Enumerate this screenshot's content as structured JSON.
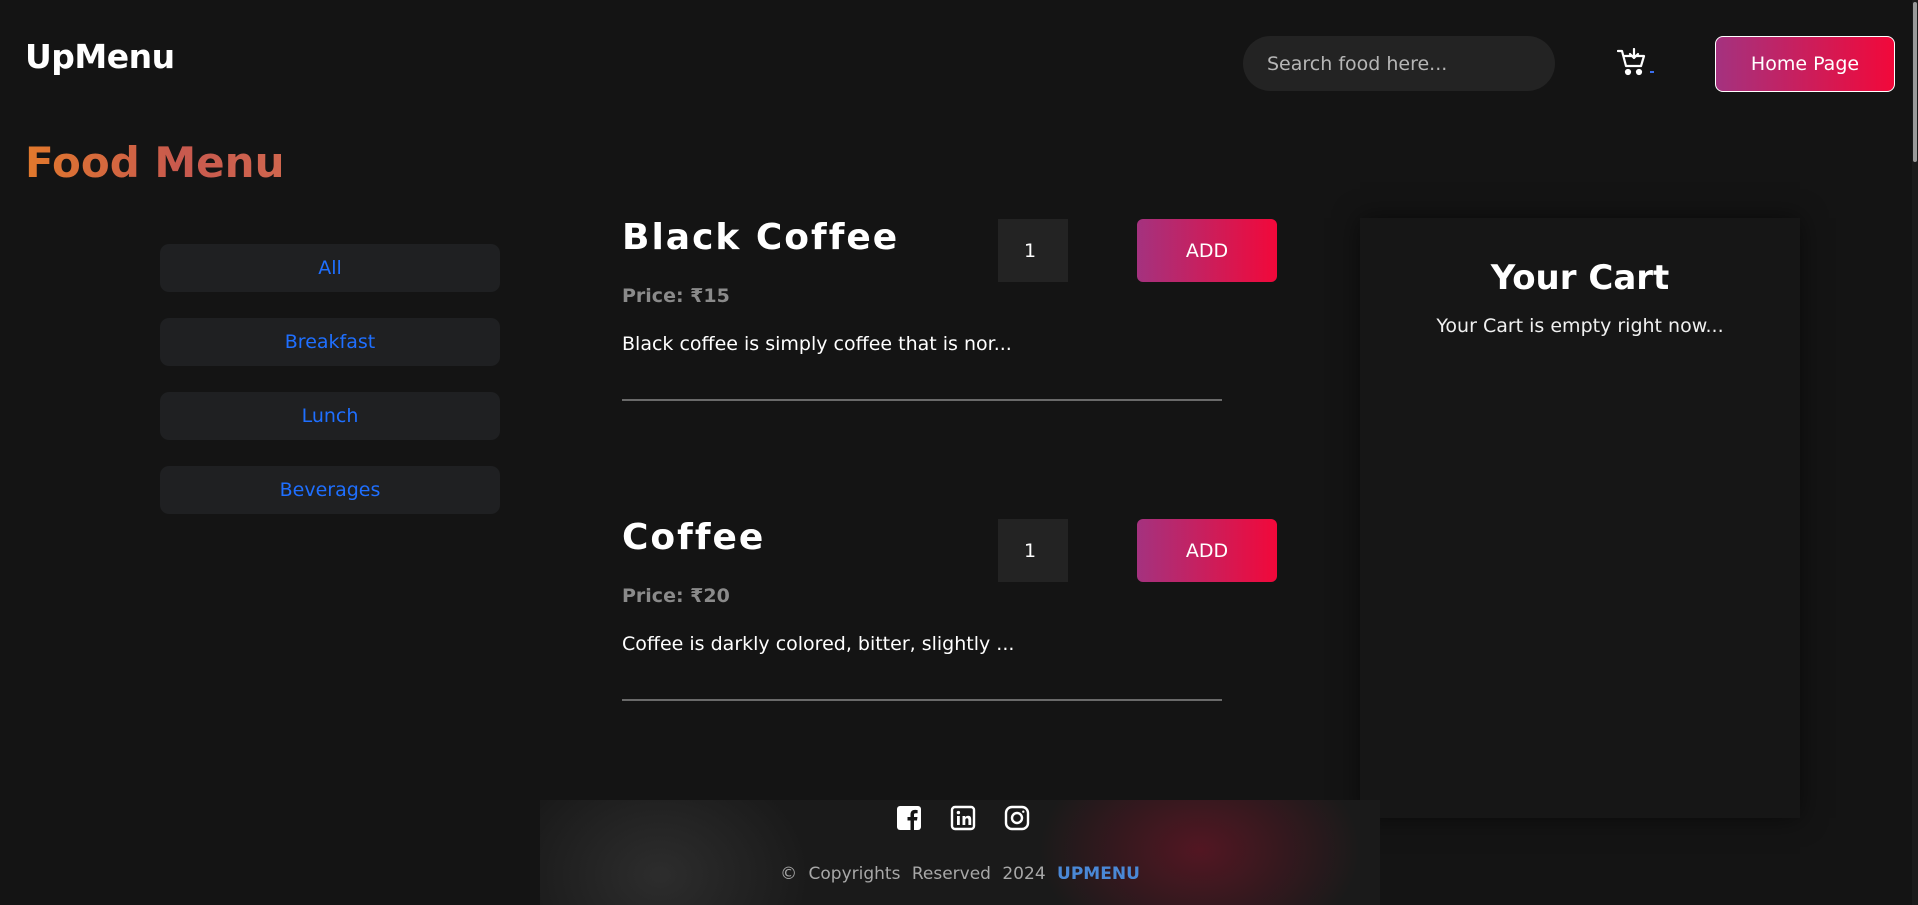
{
  "header": {
    "logo": "UpMenu",
    "search_placeholder": "Search food here...",
    "home_button": "Home Page"
  },
  "page_title": "Food Menu",
  "categories": [
    "All",
    "Breakfast",
    "Lunch",
    "Beverages"
  ],
  "menu": {
    "items": [
      {
        "name": "Black Coffee",
        "price": "Price: ₹15",
        "description": "Black coffee is simply coffee that is nor...",
        "quantity": "1",
        "add_label": "ADD"
      },
      {
        "name": "Coffee",
        "price": "Price: ₹20",
        "description": "Coffee is darkly colored, bitter, slightly ...",
        "quantity": "1",
        "add_label": "ADD"
      }
    ]
  },
  "cart": {
    "title": "Your Cart",
    "empty_message": "Your Cart is empty right now..."
  },
  "footer": {
    "social_icons": [
      "facebook-icon",
      "linkedin-icon",
      "instagram-icon"
    ],
    "copyright": "© Copyrights Reserved 2024",
    "brand": "UPMENU"
  },
  "colors": {
    "background": "#141414",
    "accent_gradient_start": "#a4327f",
    "accent_gradient_end": "#f2083a",
    "category_text": "#1f6fff",
    "title_gradient_start": "#e2792c",
    "brand_link": "#4a88d6"
  }
}
